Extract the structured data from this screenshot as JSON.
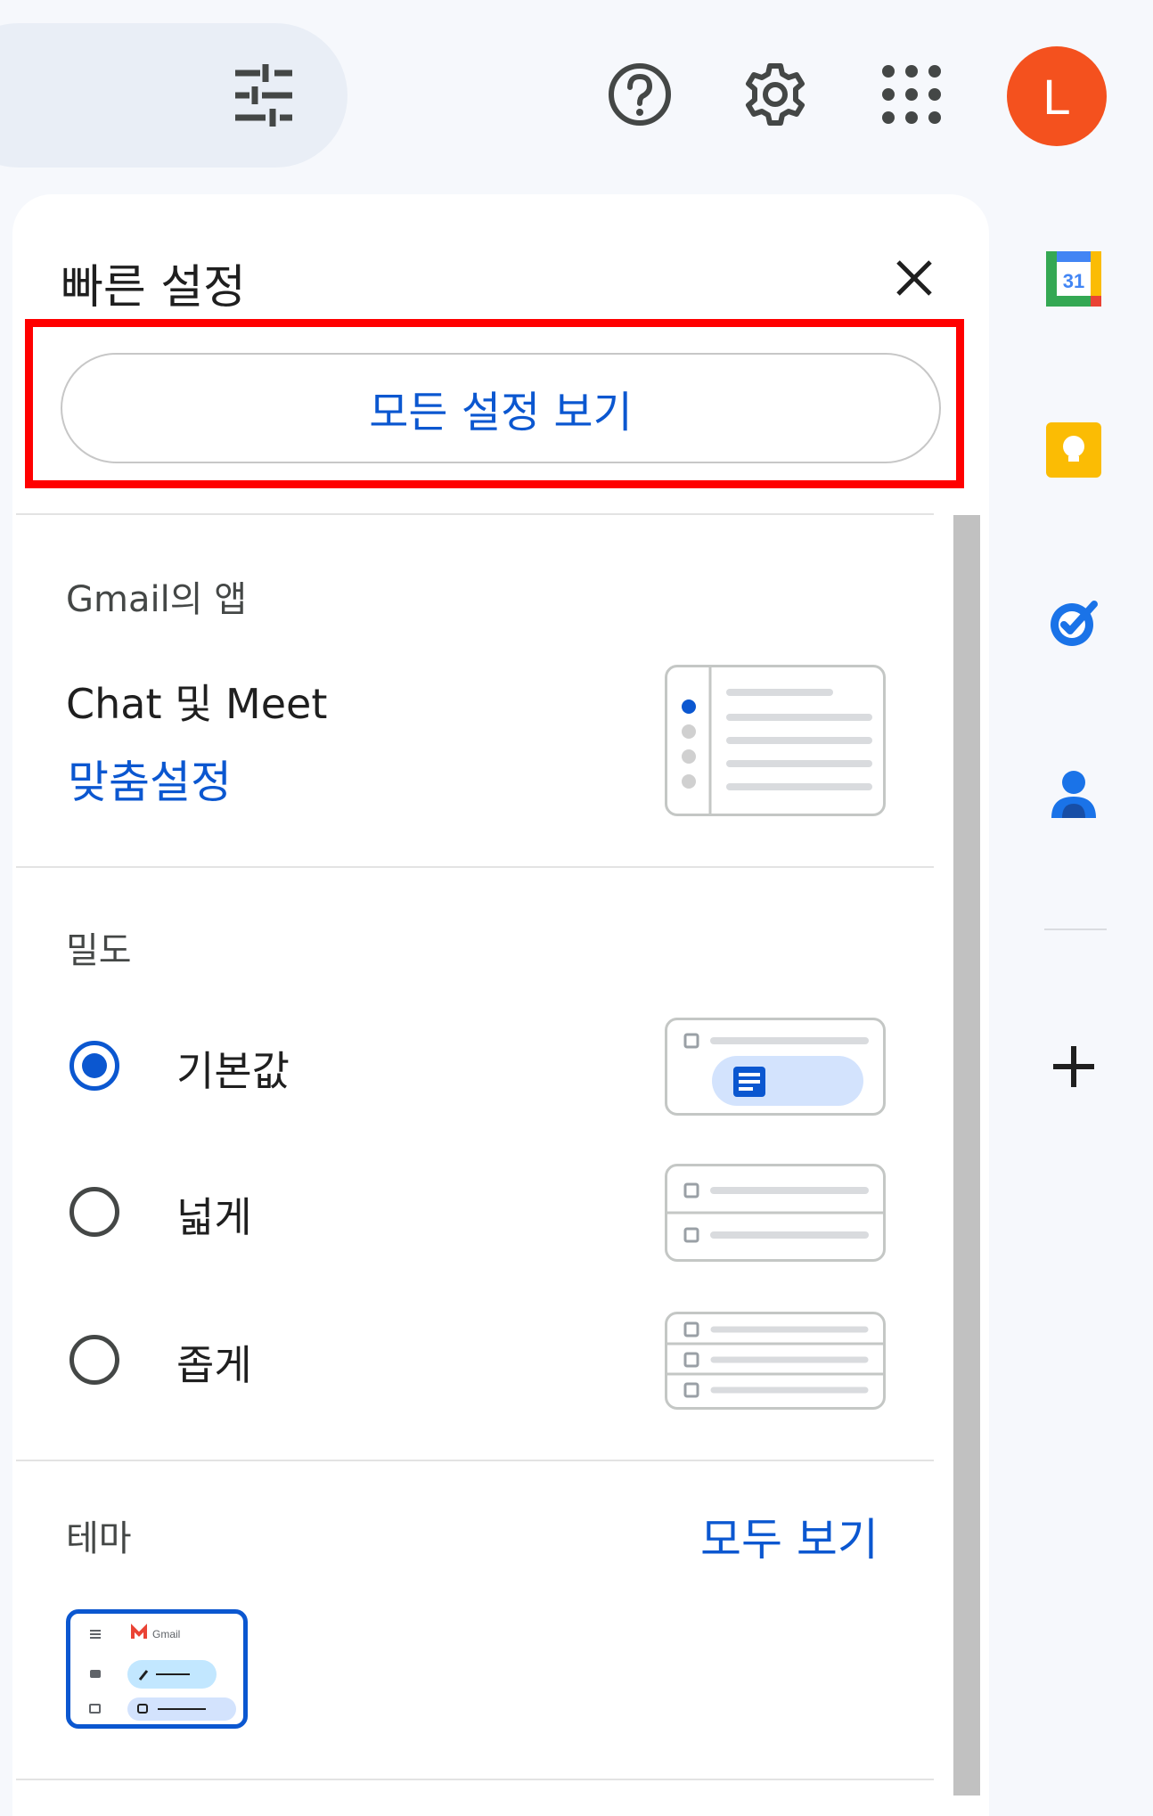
{
  "header": {
    "icons": [
      "filter-icon",
      "help-icon",
      "settings-gear-icon",
      "apps-grid-icon"
    ],
    "avatar_letter": "L",
    "avatar_color": "#f4511e"
  },
  "quick_settings": {
    "title": "빠른 설정",
    "all_settings_label": "모든 설정 보기",
    "apps_section": {
      "label": "Gmail의 앱",
      "item": "Chat 및 Meet",
      "customize_link": "맞춤설정"
    },
    "density_section": {
      "label": "밀도",
      "options": [
        {
          "label": "기본값",
          "selected": true
        },
        {
          "label": "넓게",
          "selected": false
        },
        {
          "label": "좁게",
          "selected": false
        }
      ]
    },
    "theme_section": {
      "label": "테마",
      "view_all_link": "모두 보기",
      "theme_thumb_brand": "Gmail"
    }
  },
  "side_panel": {
    "icons": [
      "calendar-icon",
      "keep-icon",
      "tasks-icon",
      "contacts-icon",
      "add-icon"
    ],
    "calendar_day": "31"
  },
  "colors": {
    "accent": "#0b57d0",
    "highlight": "#ff0000"
  }
}
